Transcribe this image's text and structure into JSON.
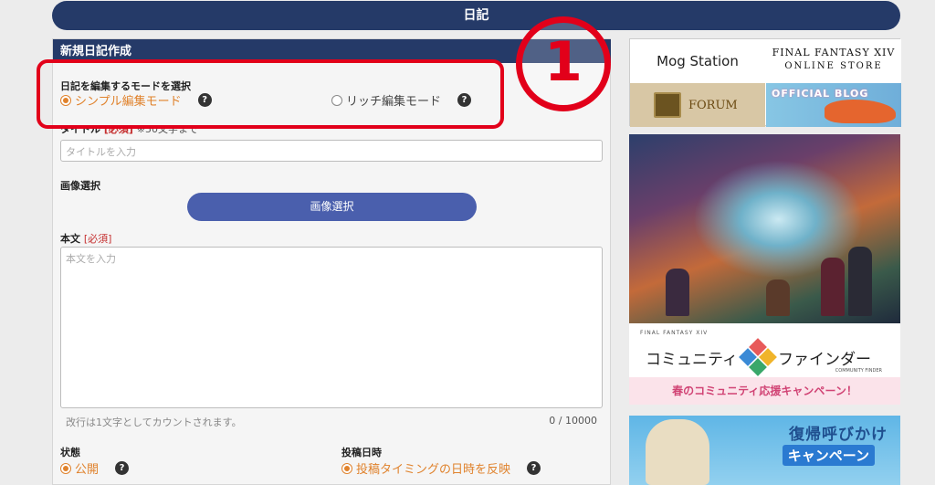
{
  "header": {
    "title": "日記"
  },
  "panel": {
    "title": "新規日記作成",
    "mode": {
      "label": "日記を編集するモードを選択",
      "simple": "シンプル編集モード",
      "rich": "リッチ編集モード",
      "help": "?"
    },
    "title_field": {
      "label": "タイトル",
      "required": "[必須]",
      "note": "※50文字まで",
      "placeholder": "タイトルを入力"
    },
    "image": {
      "label": "画像選択",
      "button": "画像選択"
    },
    "body": {
      "label": "本文",
      "required": "[必須]",
      "placeholder": "本文を入力",
      "hint": "改行は1文字としてカウントされます。",
      "counter": "0 / 10000"
    },
    "state": {
      "label": "状態",
      "value": "公開"
    },
    "post_date": {
      "label": "投稿日時",
      "value": "投稿タイミングの日時を反映"
    }
  },
  "annotation": {
    "number": "1"
  },
  "sidebar": {
    "mogstation": "Mog Station",
    "store_line1": "FINAL FANTASY XIV",
    "store_line2": "ONLINE STORE",
    "forum": "FORUM",
    "blog": "OFFICIAL BLOG",
    "cf_sub": "FINAL FANTASY XIV",
    "cf_left": "コミュニティ",
    "cf_right": "ファインダー",
    "cf_small": "COMMUNITY FINDER",
    "cf_campaign": "春のコミュニティ応援キャンペーン！",
    "return_title": "復帰呼びかけ",
    "return_sub": "キャンペーン"
  },
  "colors": {
    "navy": "#253a68",
    "accent_orange": "#e0822c",
    "button_blue": "#4a5fad",
    "annotation_red": "#e2001a",
    "required_red": "#c53030"
  }
}
